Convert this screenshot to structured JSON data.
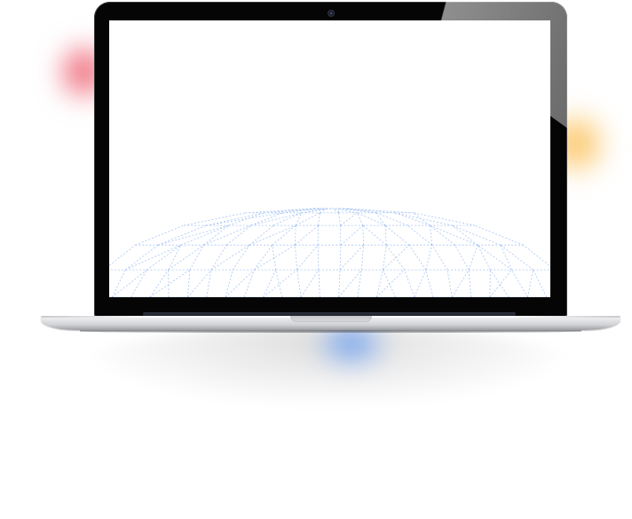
{
  "device": {
    "type": "laptop",
    "screen": {
      "background": "#ffffff",
      "graphic": "geodesic-dome-wireframe",
      "graphic_color": "#9bbcf0"
    },
    "accent_glows": {
      "top_left": "#ea465a",
      "right": "#fab43c",
      "bottom": "#508cf0"
    }
  }
}
